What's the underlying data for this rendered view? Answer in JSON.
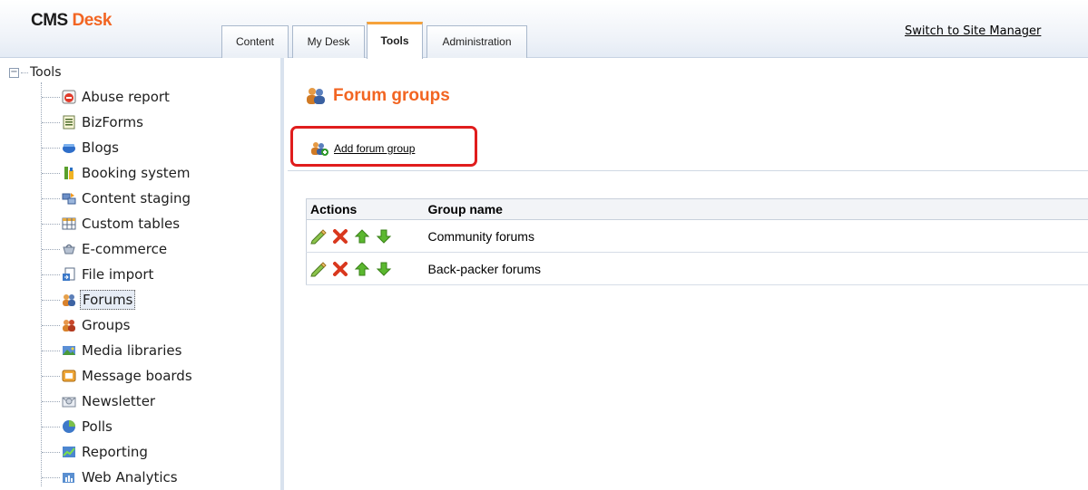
{
  "app": {
    "logo_cms": "CMS",
    "logo_desk": "Desk"
  },
  "tabs": [
    {
      "label": "Content",
      "active": false
    },
    {
      "label": "My Desk",
      "active": false
    },
    {
      "label": "Tools",
      "active": true
    },
    {
      "label": "Administration",
      "active": false
    }
  ],
  "header": {
    "switch_link": "Switch to Site Manager"
  },
  "tree": {
    "root": "Tools",
    "expander": "−",
    "items": [
      {
        "label": "Abuse report",
        "icon": "abuse-report-icon"
      },
      {
        "label": "BizForms",
        "icon": "bizforms-icon"
      },
      {
        "label": "Blogs",
        "icon": "blogs-icon"
      },
      {
        "label": "Booking system",
        "icon": "booking-system-icon"
      },
      {
        "label": "Content staging",
        "icon": "content-staging-icon"
      },
      {
        "label": "Custom tables",
        "icon": "custom-tables-icon"
      },
      {
        "label": "E-commerce",
        "icon": "ecommerce-icon"
      },
      {
        "label": "File import",
        "icon": "file-import-icon"
      },
      {
        "label": "Forums",
        "icon": "forums-icon",
        "selected": true
      },
      {
        "label": "Groups",
        "icon": "groups-icon"
      },
      {
        "label": "Media libraries",
        "icon": "media-libraries-icon"
      },
      {
        "label": "Message boards",
        "icon": "message-boards-icon"
      },
      {
        "label": "Newsletter",
        "icon": "newsletter-icon"
      },
      {
        "label": "Polls",
        "icon": "polls-icon"
      },
      {
        "label": "Reporting",
        "icon": "reporting-icon"
      },
      {
        "label": "Web Analytics",
        "icon": "web-analytics-icon"
      }
    ]
  },
  "main": {
    "title": "Forum groups",
    "add_action": "Add forum group",
    "table": {
      "headers": [
        "Actions",
        "Group name"
      ],
      "rows": [
        {
          "name": "Community forums"
        },
        {
          "name": "Back-packer forums"
        }
      ]
    }
  },
  "colors": {
    "accent": "#f26522",
    "highlight_border": "#e01d1d",
    "active_tab": "#f6a23b"
  }
}
